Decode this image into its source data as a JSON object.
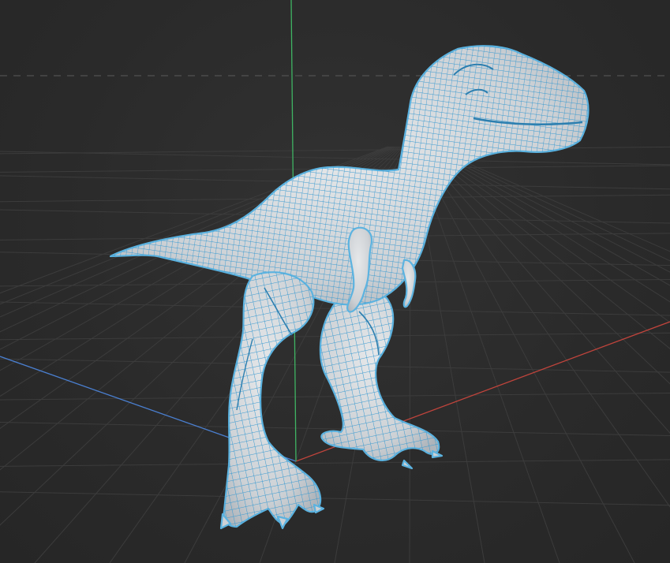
{
  "viewport": {
    "mode": "3d-perspective",
    "background_color": "#2b2b2b",
    "grid_color": "#3c3c3c",
    "horizon_dash_color": "#5a5a5a"
  },
  "axes": {
    "x_color": "#c0443c",
    "y_color": "#4a7fd0",
    "z_color": "#3fb463"
  },
  "model": {
    "object": "tyrannosaurus",
    "display": "wireframe-on-shaded",
    "surface_color": "#d9dcdf",
    "wire_color": "#3a9ad0",
    "outline_color": "#5cb3e0",
    "selected": true
  }
}
